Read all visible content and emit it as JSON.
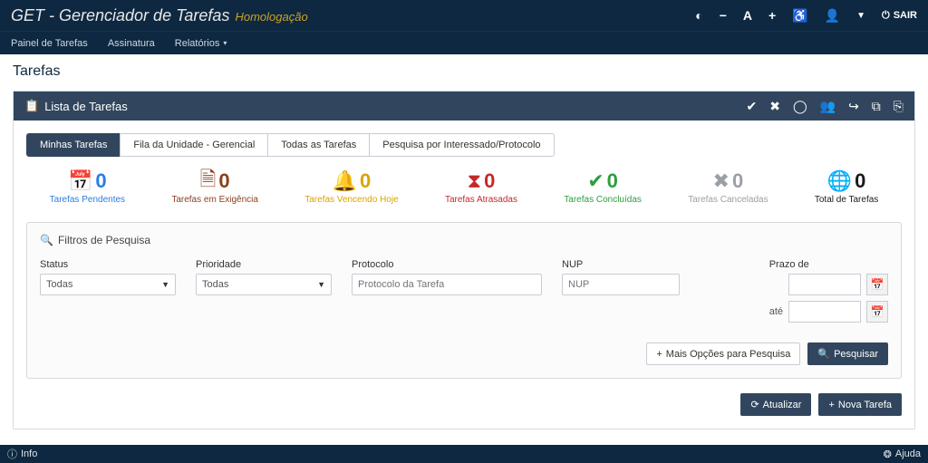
{
  "app": {
    "title": "GET - Gerenciador de Tarefas",
    "env": "Homologação"
  },
  "top_actions": {
    "sair": "SAIR"
  },
  "nav": {
    "painel": "Painel de Tarefas",
    "assinatura": "Assinatura",
    "relatorios": "Relatórios"
  },
  "page": {
    "title": "Tarefas"
  },
  "panel": {
    "header": "Lista de Tarefas"
  },
  "tabs": {
    "minhas": "Minhas Tarefas",
    "fila": "Fila da Unidade - Gerencial",
    "todas": "Todas as Tarefas",
    "pesquisa": "Pesquisa por Interessado/Protocolo"
  },
  "stats": {
    "pendentes": {
      "count": "0",
      "label": "Tarefas Pendentes"
    },
    "exigencia": {
      "count": "0",
      "label": "Tarefas em Exigência"
    },
    "vencendo": {
      "count": "0",
      "label": "Tarefas Vencendo Hoje"
    },
    "atrasadas": {
      "count": "0",
      "label": "Tarefas Atrasadas"
    },
    "concluidas": {
      "count": "0",
      "label": "Tarefas Concluídas"
    },
    "canceladas": {
      "count": "0",
      "label": "Tarefas Canceladas"
    },
    "total": {
      "count": "0",
      "label": "Total de Tarefas"
    }
  },
  "filters": {
    "title": "Filtros de Pesquisa",
    "status_label": "Status",
    "status_value": "Todas",
    "prioridade_label": "Prioridade",
    "prioridade_value": "Todas",
    "protocolo_label": "Protocolo",
    "protocolo_placeholder": "Protocolo da Tarefa",
    "nup_label": "NUP",
    "nup_placeholder": "NUP",
    "prazo_label": "Prazo de",
    "ate_label": "até",
    "mais_opcoes": "Mais Opções para Pesquisa",
    "pesquisar": "Pesquisar"
  },
  "actions": {
    "atualizar": "Atualizar",
    "nova": "Nova Tarefa"
  },
  "bottom": {
    "info": "Info",
    "ajuda": "Ajuda"
  }
}
